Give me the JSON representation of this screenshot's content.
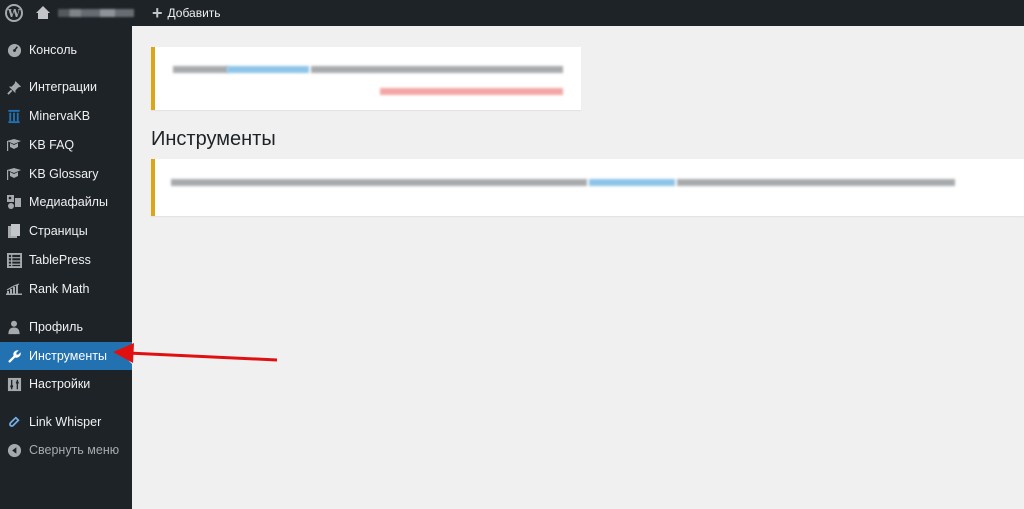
{
  "admin_bar": {
    "wp_logo": "wordpress-logo-icon",
    "site_name_blurred": true,
    "new_label": "Добавить"
  },
  "sidebar": {
    "items": [
      {
        "label": "Консоль",
        "icon": "dashboard-icon"
      },
      {
        "label": "Интеграции",
        "icon": "pin-icon"
      },
      {
        "label": "MinervaKB",
        "icon": "bank-icon"
      },
      {
        "label": "KB FAQ",
        "icon": "mortarboard-icon"
      },
      {
        "label": "KB Glossary",
        "icon": "mortarboard-icon"
      },
      {
        "label": "Медиафайлы",
        "icon": "media-icon"
      },
      {
        "label": "Страницы",
        "icon": "pages-icon"
      },
      {
        "label": "TablePress",
        "icon": "table-icon"
      },
      {
        "label": "Rank Math",
        "icon": "chart-icon"
      },
      {
        "label": "Профиль",
        "icon": "user-icon"
      },
      {
        "label": "Инструменты",
        "icon": "wrench-icon",
        "current": true
      },
      {
        "label": "Настройки",
        "icon": "settings-icon"
      },
      {
        "label": "Link Whisper",
        "icon": "link-icon"
      },
      {
        "label": "Свернуть меню",
        "icon": "collapse-icon"
      }
    ]
  },
  "main": {
    "page_title": "Инструменты",
    "notices": [
      {
        "type": "warning",
        "text_blurred": true,
        "has_link": true,
        "has_red_action": true
      },
      {
        "type": "warning",
        "text_blurred": true,
        "has_link": true
      }
    ]
  },
  "colors": {
    "sidebar_bg": "#1d2327",
    "current_item": "#2271b1",
    "notice_warning_border": "#dba617",
    "annotation_arrow": "#e01010"
  },
  "annotation": {
    "type": "arrow",
    "points_to": "Инструменты"
  }
}
